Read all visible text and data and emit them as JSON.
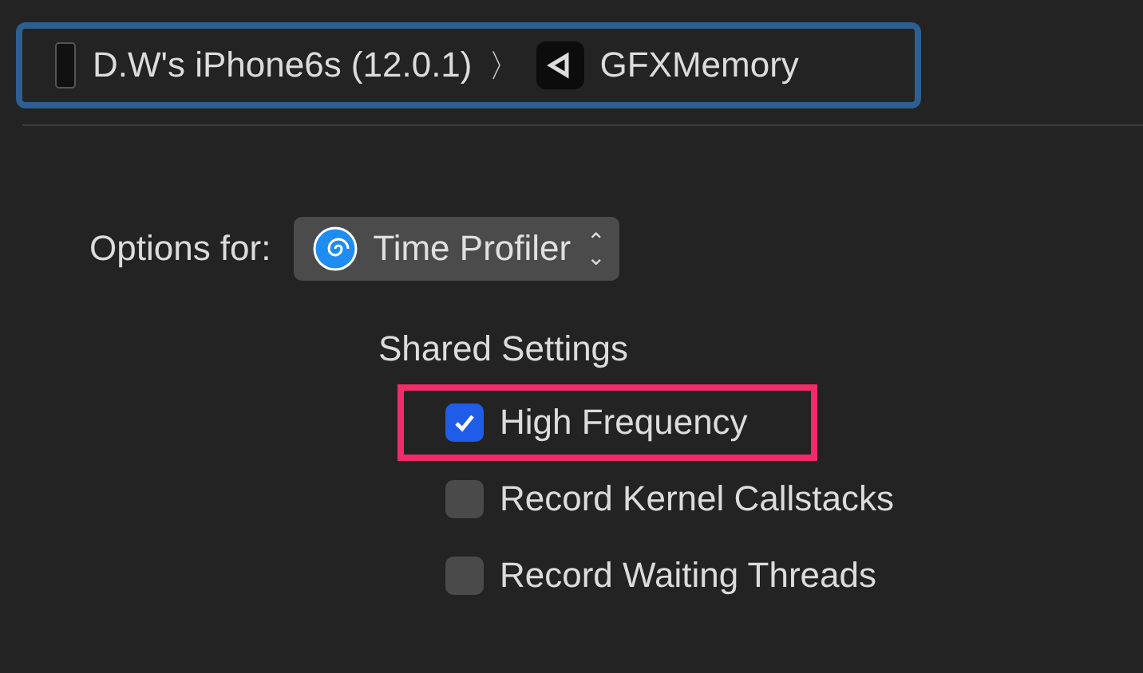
{
  "breadcrumb": {
    "device": "D.W's iPhone6s (12.0.1)",
    "separator": "〉",
    "app": "GFXMemory"
  },
  "options_for": {
    "label": "Options for:",
    "popup_value": "Time Profiler",
    "popup_arrows": "⌃⌄"
  },
  "shared_settings": {
    "title": "Shared Settings",
    "options": [
      {
        "label": "High Frequency",
        "checked": true,
        "highlighted": true
      },
      {
        "label": "Record Kernel Callstacks",
        "checked": false,
        "highlighted": false
      },
      {
        "label": "Record Waiting Threads",
        "checked": false,
        "highlighted": false
      }
    ]
  }
}
